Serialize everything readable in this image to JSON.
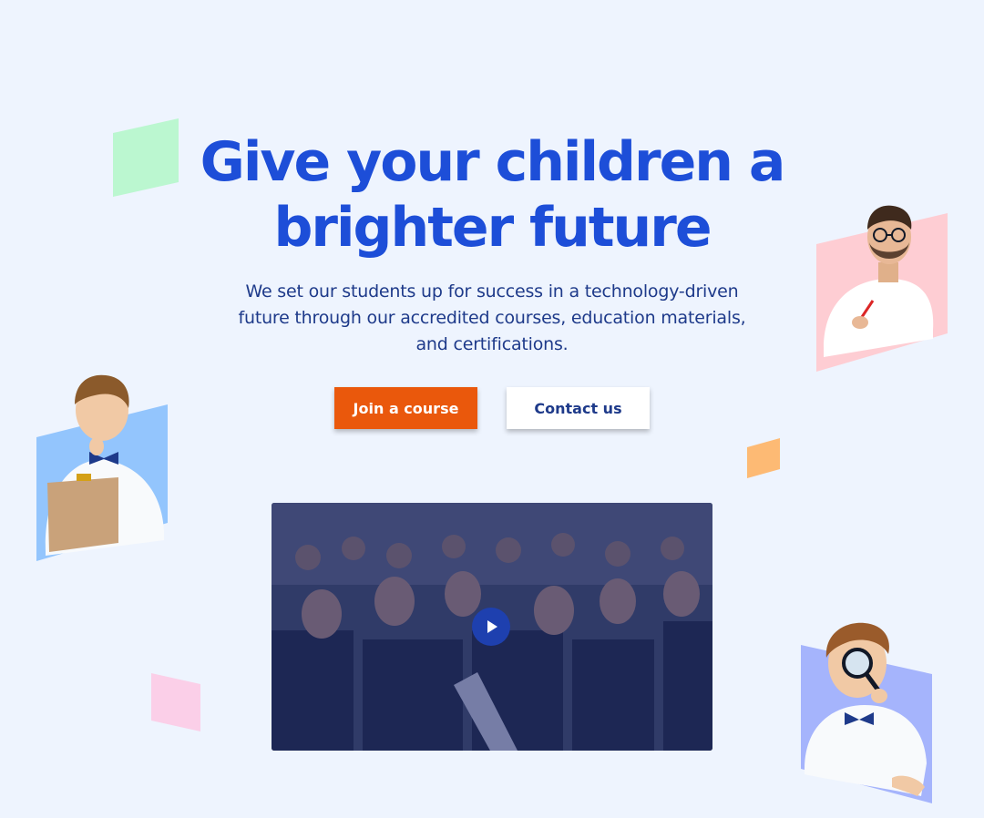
{
  "hero": {
    "headline_line1": "Give your children a",
    "headline_line2": "brighter future",
    "subtitle_line1": "We set our students up for success in a technology-driven",
    "subtitle_line2": "future through our accredited courses, education materials,",
    "subtitle_line3": "and certifications."
  },
  "buttons": {
    "primary_label": "Join a course",
    "secondary_label": "Contact us"
  },
  "video": {
    "play_icon": "play-icon"
  },
  "colors": {
    "background": "#eef4fe",
    "headline": "#1d4ed8",
    "subtitle": "#1e3a8a",
    "primary_button": "#ea580c",
    "secondary_button": "#ffffff",
    "accent_green": "#bbf7d0",
    "accent_pink": "#fbcfe8",
    "accent_orange": "#fdba74",
    "card_blue": "#93c5fd",
    "card_pink": "#fecdd3",
    "card_violet": "#a5b4fc"
  }
}
